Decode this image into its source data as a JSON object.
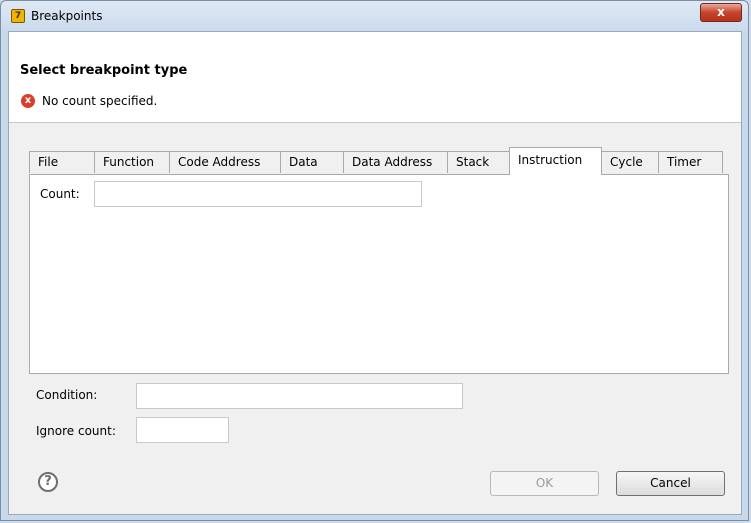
{
  "window": {
    "title": "Breakpoints",
    "close_label": "x"
  },
  "header": {
    "title": "Select breakpoint type",
    "error_message": "No count specified."
  },
  "tabs": [
    {
      "label": "File"
    },
    {
      "label": "Function"
    },
    {
      "label": "Code Address"
    },
    {
      "label": "Data"
    },
    {
      "label": "Data Address"
    },
    {
      "label": "Stack"
    },
    {
      "label": "Instruction",
      "active": true
    },
    {
      "label": "Cycle"
    },
    {
      "label": "Timer"
    }
  ],
  "panel": {
    "count_label": "Count:",
    "count_value": ""
  },
  "fields": {
    "condition_label": "Condition:",
    "condition_value": "",
    "ignore_count_label": "Ignore count:",
    "ignore_count_value": ""
  },
  "buttons": {
    "ok_label": "OK",
    "cancel_label": "Cancel",
    "help_glyph": "?"
  },
  "icons": {
    "error_glyph": "x",
    "app_glyph": "7"
  },
  "colors": {
    "error": "#d8402b",
    "close": "#c7432b",
    "app_icon": "#f0b400"
  }
}
